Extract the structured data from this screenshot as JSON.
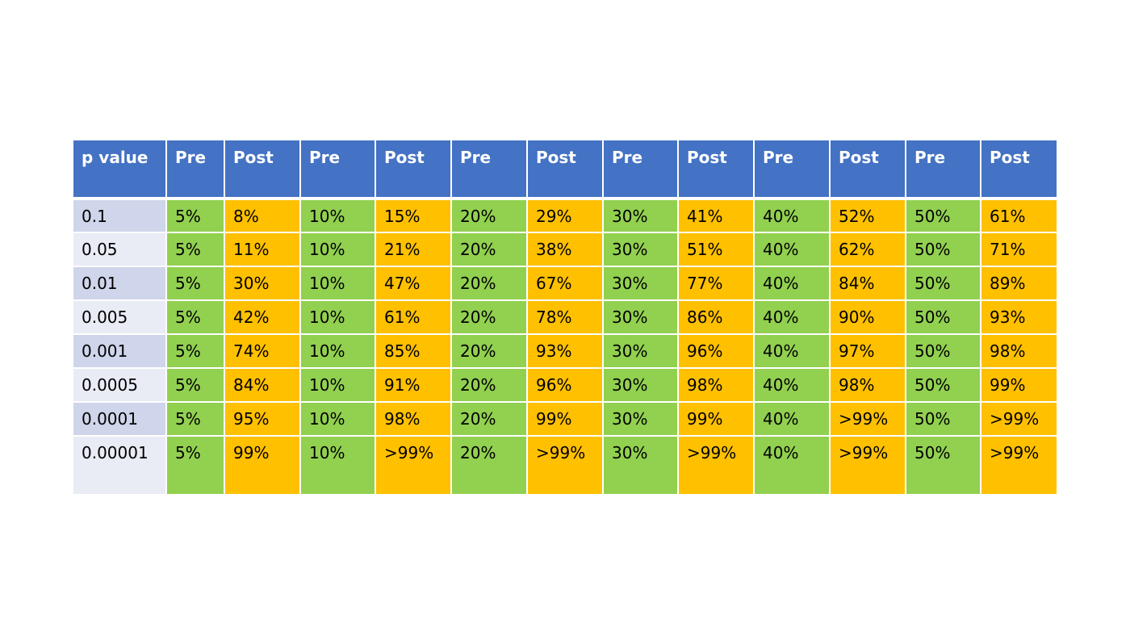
{
  "colors": {
    "header": "#4472c4",
    "pre": "#92d050",
    "post": "#ffc000",
    "pvalue_band_dark": "#cfd5ea",
    "pvalue_band_light": "#e9ebf5"
  },
  "table": {
    "headers": [
      "p value",
      "Pre",
      "Post",
      "Pre",
      "Post",
      "Pre",
      "Post",
      "Pre",
      "Post",
      "Pre",
      "Post",
      "Pre",
      "Post"
    ],
    "rows": [
      [
        "0.1",
        "5%",
        "8%",
        "10%",
        "15%",
        "20%",
        "29%",
        "30%",
        "41%",
        "40%",
        "52%",
        "50%",
        "61%"
      ],
      [
        "0.05",
        "5%",
        "11%",
        "10%",
        "21%",
        "20%",
        "38%",
        "30%",
        "51%",
        "40%",
        "62%",
        "50%",
        "71%"
      ],
      [
        "0.01",
        "5%",
        "30%",
        "10%",
        "47%",
        "20%",
        "67%",
        "30%",
        "77%",
        "40%",
        "84%",
        "50%",
        "89%"
      ],
      [
        "0.005",
        "5%",
        "42%",
        "10%",
        "61%",
        "20%",
        "78%",
        "30%",
        "86%",
        "40%",
        "90%",
        "50%",
        "93%"
      ],
      [
        "0.001",
        "5%",
        "74%",
        "10%",
        "85%",
        "20%",
        "93%",
        "30%",
        "96%",
        "40%",
        "97%",
        "50%",
        "98%"
      ],
      [
        "0.0005",
        "5%",
        "84%",
        "10%",
        "91%",
        "20%",
        "96%",
        "30%",
        "98%",
        "40%",
        "98%",
        "50%",
        "99%"
      ],
      [
        "0.0001",
        "5%",
        "95%",
        "10%",
        "98%",
        "20%",
        "99%",
        "30%",
        "99%",
        "40%",
        ">99%",
        "50%",
        ">99%"
      ],
      [
        "0.00001",
        "5%",
        "99%",
        "10%",
        ">99%",
        "20%",
        ">99%",
        "30%",
        ">99%",
        "40%",
        ">99%",
        "50%",
        ">99%"
      ]
    ]
  }
}
